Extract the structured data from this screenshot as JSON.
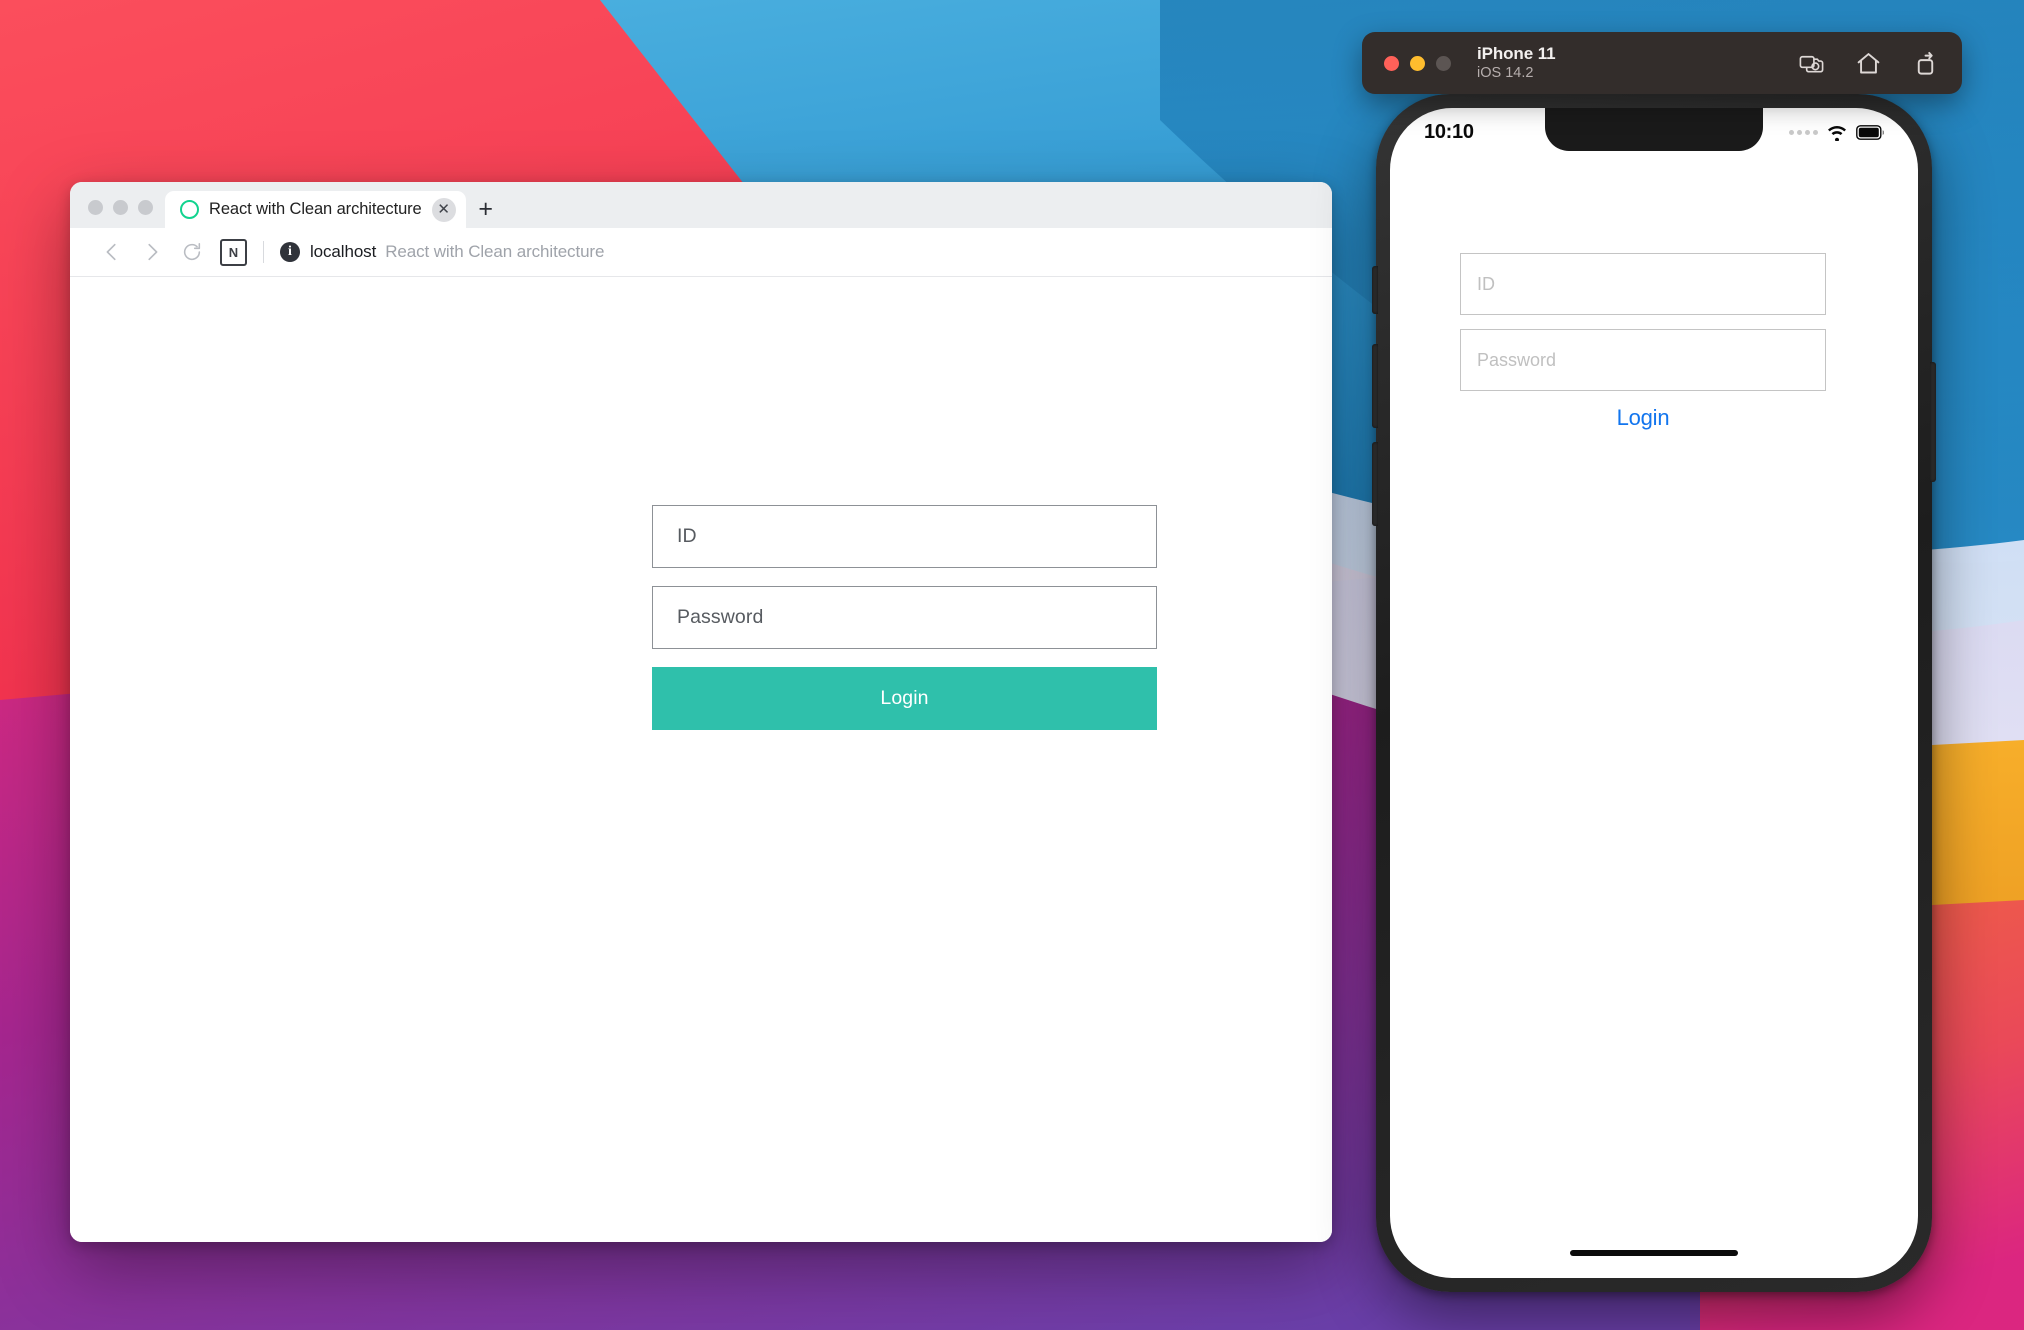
{
  "desktop": {
    "wallpaper_colors": {
      "red": "#f8474f",
      "pink": "#e8246e",
      "magenta": "#b0218c",
      "purple": "#6e3fa8",
      "blue": "#2f9ad6",
      "blue_dark": "#1f7ab4",
      "light_blue": "#c3d3f2",
      "orange": "#f5a623",
      "orange_red": "#f2603c"
    }
  },
  "browser": {
    "traffic_lights": [
      "close",
      "minimize",
      "zoom"
    ],
    "tab": {
      "favicon": "circle-outline-icon",
      "title": "React with Clean architecture",
      "close_label": "✕"
    },
    "new_tab_label": "+",
    "nav": {
      "back_label": "‹",
      "forward_label": "›",
      "reload_label": "reload-icon",
      "extension_label": "N",
      "security_label": "i",
      "url_host": "localhost",
      "url_rest": "React with Clean architecture"
    },
    "page": {
      "id_placeholder": "ID",
      "password_placeholder": "Password",
      "login_label": "Login",
      "login_button_color": "#2fc0ab"
    }
  },
  "simulator": {
    "toolbar": {
      "device_name": "iPhone 11",
      "os_version": "iOS 14.2",
      "actions": [
        "screenshot-icon",
        "home-icon",
        "rotate-icon"
      ]
    },
    "status_bar": {
      "time": "10:10",
      "signal": "signal-dots-icon",
      "wifi": "wifi-icon",
      "battery": "battery-icon"
    },
    "page": {
      "id_placeholder": "ID",
      "password_placeholder": "Password",
      "login_label": "Login",
      "login_link_color": "#1275ee"
    }
  }
}
